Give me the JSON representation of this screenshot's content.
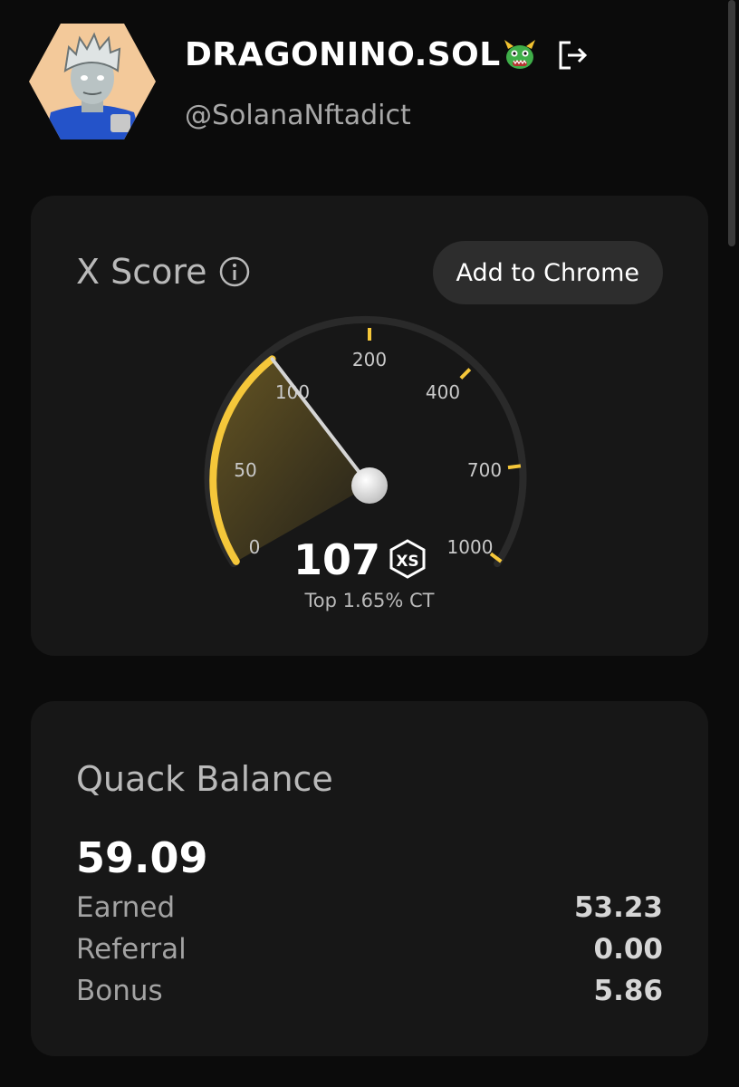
{
  "profile": {
    "display_name": "DRAGONINO.SOL",
    "name_emoji_icon": "dragon-emoji-icon",
    "handle": "@SolanaNftadict",
    "logout_icon": "logout-icon"
  },
  "xscore": {
    "title": "X Score",
    "info_icon": "info-icon",
    "add_button": "Add to Chrome",
    "score": "107",
    "score_badge_icon": "xs-badge-icon",
    "rank": "Top 1.65% CT",
    "scale": {
      "ticks": [
        "0",
        "50",
        "100",
        "200",
        "400",
        "700",
        "1000"
      ],
      "min": 0,
      "max": 1000,
      "value": 107
    },
    "colors": {
      "accent": "#f5c73a",
      "track": "#2a2a2a",
      "card": "#171717"
    }
  },
  "balance": {
    "title": "Quack Balance",
    "total": "59.09",
    "rows": [
      {
        "label": "Earned",
        "value": "53.23"
      },
      {
        "label": "Referral",
        "value": "0.00"
      },
      {
        "label": "Bonus",
        "value": "5.86"
      }
    ]
  }
}
